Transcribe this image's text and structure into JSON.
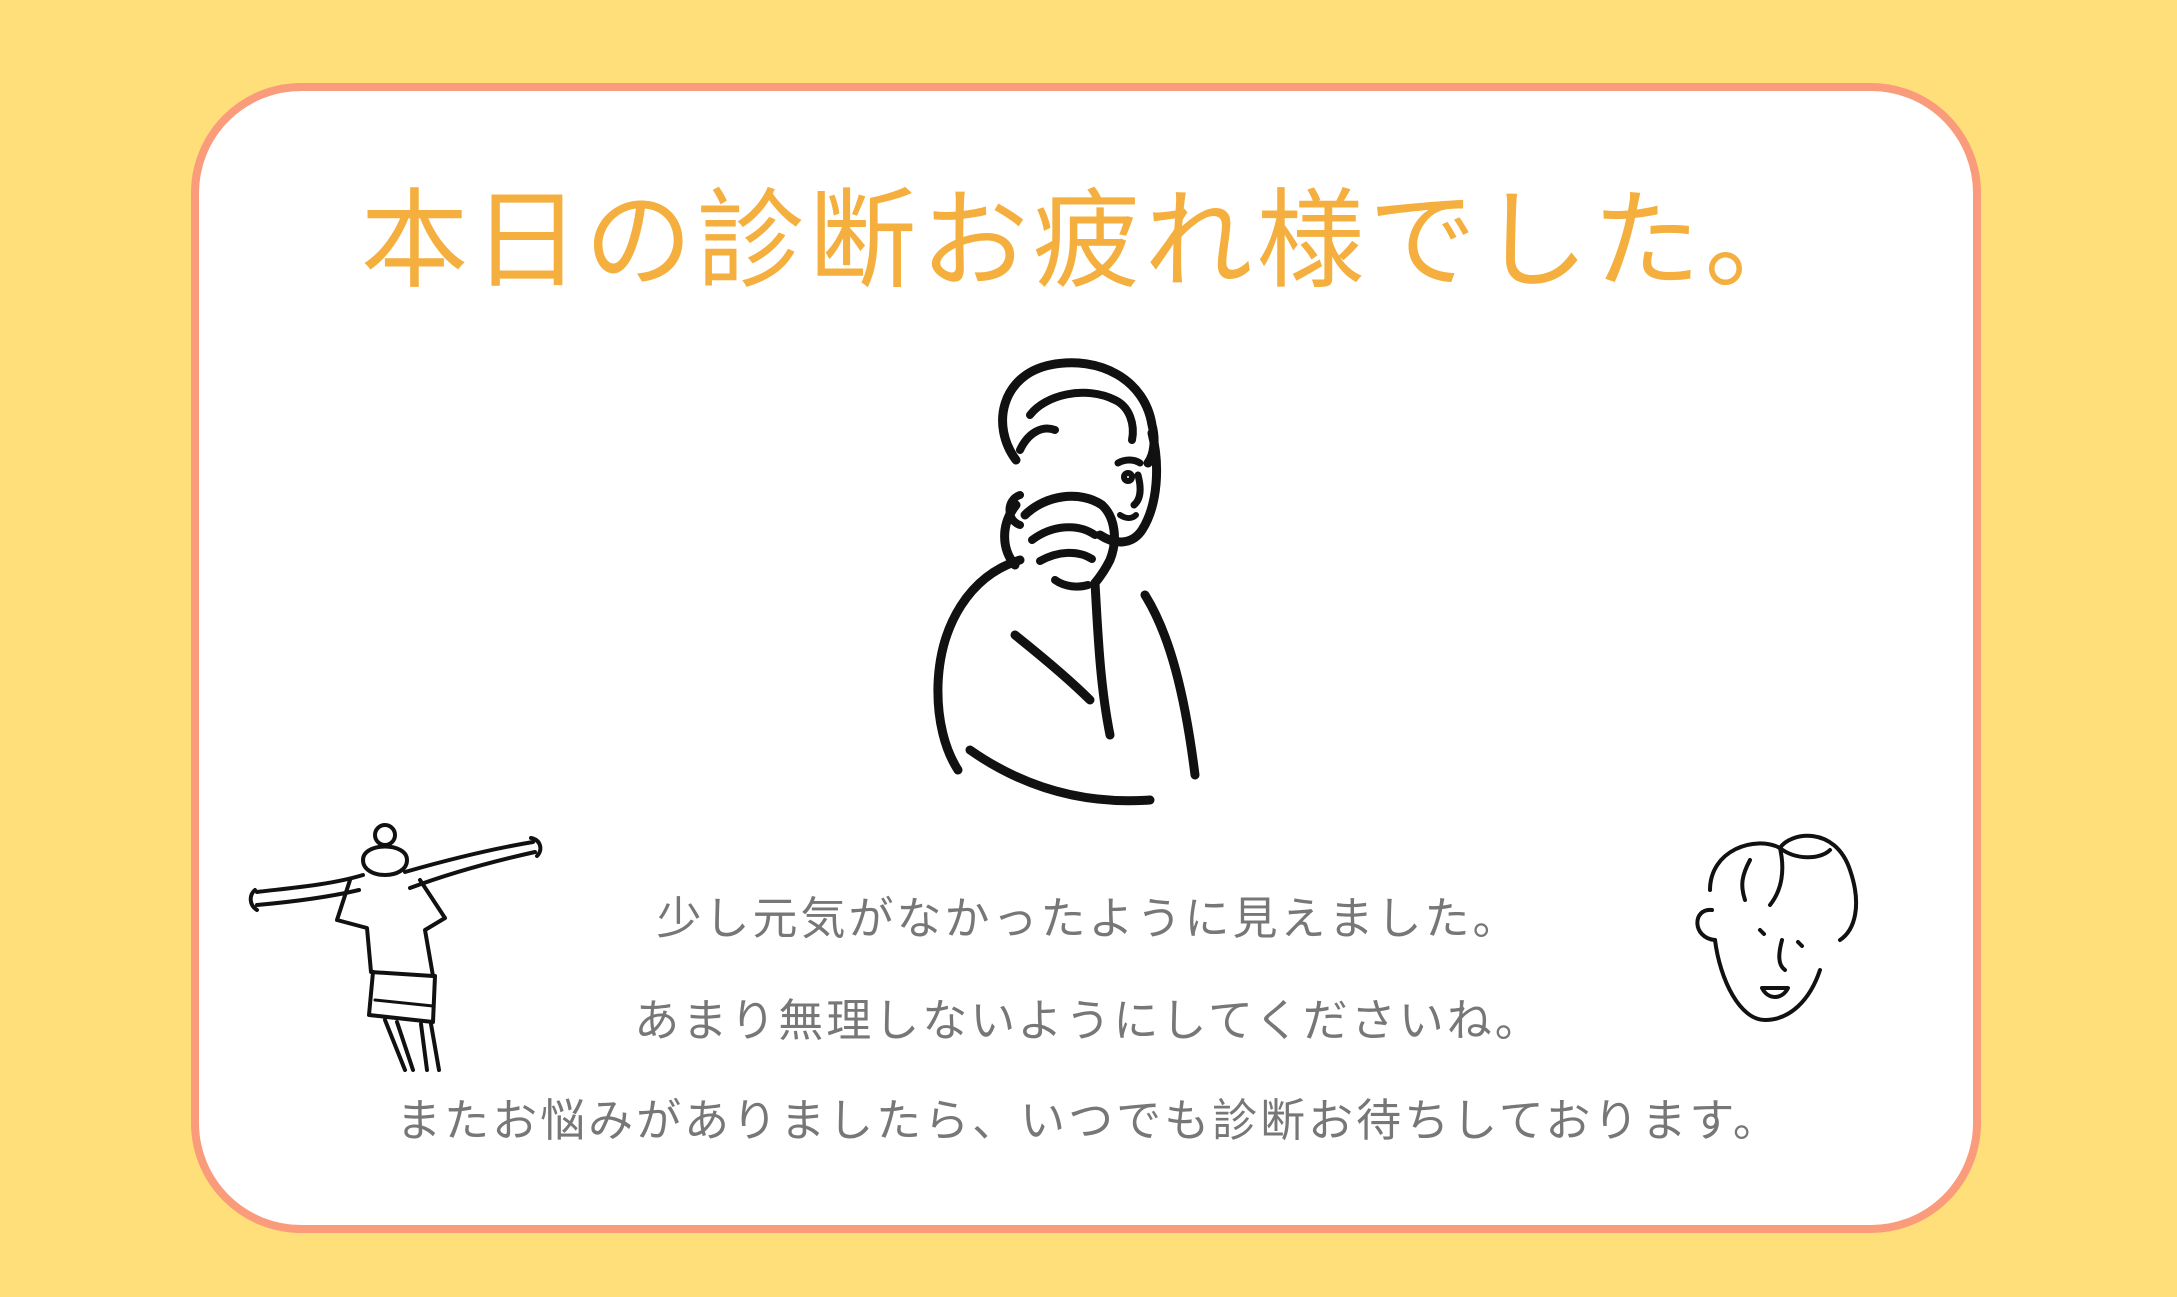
{
  "title": "本日の診断お疲れ様でした。",
  "messages": [
    "少し元気がなかったように見えました。",
    "あまり無理しないようにしてくださいね。",
    "またお悩みがありましたら、いつでも診断お待ちしております。"
  ],
  "illustrations": {
    "center": "thinking-person-illustration",
    "left": "stretching-person-illustration",
    "right": "smiling-face-illustration"
  },
  "colors": {
    "background": "#FFDF7A",
    "card": "#FFFFFF",
    "card_border": "#FA9C7C",
    "title": "#F4AF3E",
    "text": "#777777",
    "line_art": "#111111"
  }
}
